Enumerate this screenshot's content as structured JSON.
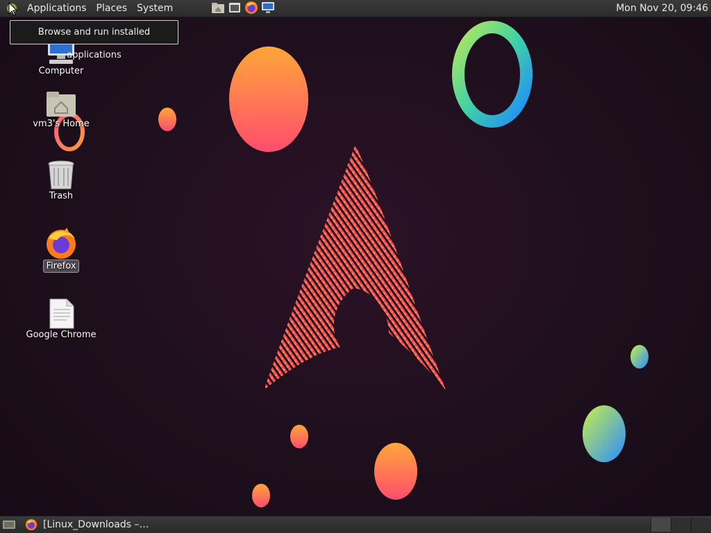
{
  "top_panel": {
    "menus": [
      "Applications",
      "Places",
      "System"
    ],
    "launchers": [
      "home-folder-icon",
      "terminal-window-icon",
      "firefox-icon",
      "monitor-icon"
    ],
    "clock": "Mon Nov 20, 09:46"
  },
  "tooltip": {
    "text": "Browse and run installed applications"
  },
  "desktop": {
    "icons": [
      {
        "label": "Computer",
        "icon": "computer-icon"
      },
      {
        "label": "vm3's Home",
        "icon": "home-folder-icon"
      },
      {
        "label": "Trash",
        "icon": "trash-icon"
      },
      {
        "label": "Firefox",
        "icon": "firefox-icon",
        "selected": true
      },
      {
        "label": "Google Chrome",
        "icon": "document-icon"
      }
    ]
  },
  "bottom_panel": {
    "task_title": "[Linux_Downloads –…",
    "workspace_count": 3,
    "active_workspace": 1
  },
  "colors": {
    "background": "#1e0f1d",
    "accent_pink": "#e0206e",
    "accent_orange": "#ff8a3d"
  }
}
